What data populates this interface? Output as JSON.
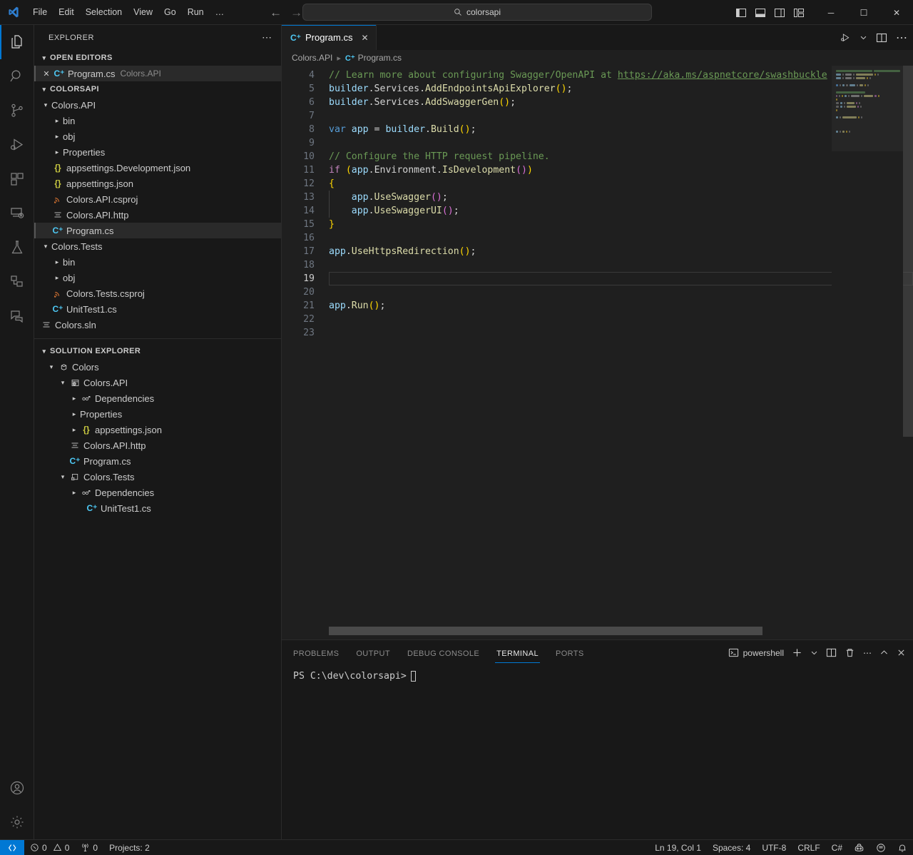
{
  "titlebar": {
    "logo": "vscode-logo-icon",
    "menus": [
      "File",
      "Edit",
      "Selection",
      "View",
      "Go",
      "Run",
      "…"
    ],
    "nav_back": "←",
    "nav_forward": "→",
    "command_center": {
      "text": "colorsapi",
      "icon": "search-icon"
    },
    "layout_icons": [
      "toggle-primary-sidebar-icon",
      "toggle-panel-icon",
      "toggle-secondary-sidebar-icon",
      "customize-layout-icon"
    ],
    "window_controls": {
      "minimize": "─",
      "maximize": "☐",
      "close": "✕"
    }
  },
  "activitybar": {
    "items": [
      {
        "name": "explorer",
        "icon": "files-icon",
        "active": true
      },
      {
        "name": "search",
        "icon": "search-icon",
        "active": false
      },
      {
        "name": "source-control",
        "icon": "source-control-icon",
        "active": false
      },
      {
        "name": "run-and-debug",
        "icon": "run-debug-icon",
        "active": false
      },
      {
        "name": "extensions",
        "icon": "extensions-icon",
        "active": false
      },
      {
        "name": "remote-explorer",
        "icon": "remote-explorer-icon",
        "active": false
      },
      {
        "name": "testing",
        "icon": "beaker-icon",
        "active": false
      },
      {
        "name": "solution-explorer",
        "icon": "solution-icon",
        "active": false
      },
      {
        "name": "chat",
        "icon": "chat-icon",
        "active": false
      }
    ],
    "bottom": [
      {
        "name": "accounts",
        "icon": "account-icon"
      },
      {
        "name": "manage-settings",
        "icon": "gear-icon"
      }
    ]
  },
  "sidebar": {
    "title": "EXPLORER",
    "more_actions": "⋯",
    "open_editors": {
      "label": "OPEN EDITORS",
      "expanded": true,
      "items": [
        {
          "name": "Program.cs",
          "description": "Colors.API",
          "icon": "csharp-icon",
          "selected": true,
          "close": "✕"
        }
      ]
    },
    "folder": {
      "label": "COLORSAPI",
      "expanded": true,
      "items": [
        {
          "label": "Colors.API",
          "depth": 1,
          "type": "folder",
          "expanded": true
        },
        {
          "label": "bin",
          "depth": 2,
          "type": "folder",
          "expanded": false
        },
        {
          "label": "obj",
          "depth": 2,
          "type": "folder",
          "expanded": false
        },
        {
          "label": "Properties",
          "depth": 2,
          "type": "folder",
          "expanded": false
        },
        {
          "label": "appsettings.Development.json",
          "depth": 2,
          "type": "json"
        },
        {
          "label": "appsettings.json",
          "depth": 2,
          "type": "json"
        },
        {
          "label": "Colors.API.csproj",
          "depth": 2,
          "type": "csproj"
        },
        {
          "label": "Colors.API.http",
          "depth": 2,
          "type": "http"
        },
        {
          "label": "Program.cs",
          "depth": 2,
          "type": "cs",
          "selected": true
        },
        {
          "label": "Colors.Tests",
          "depth": 1,
          "type": "folder",
          "expanded": true
        },
        {
          "label": "bin",
          "depth": 2,
          "type": "folder",
          "expanded": false
        },
        {
          "label": "obj",
          "depth": 2,
          "type": "folder",
          "expanded": false
        },
        {
          "label": "Colors.Tests.csproj",
          "depth": 2,
          "type": "csproj"
        },
        {
          "label": "UnitTest1.cs",
          "depth": 2,
          "type": "cs"
        },
        {
          "label": "Colors.sln",
          "depth": 1,
          "type": "sln"
        }
      ]
    },
    "solution_explorer": {
      "label": "SOLUTION EXPLORER",
      "expanded": true,
      "items": [
        {
          "label": "Colors",
          "depth": 1,
          "icon": "solution-icon",
          "twisty": "expanded"
        },
        {
          "label": "Colors.API",
          "depth": 2,
          "icon": "web-project-icon",
          "twisty": "expanded"
        },
        {
          "label": "Dependencies",
          "depth": 3,
          "icon": "dependencies-icon",
          "twisty": "collapsed"
        },
        {
          "label": "Properties",
          "depth": 3,
          "icon": "none",
          "twisty": "collapsed"
        },
        {
          "label": "appsettings.json",
          "depth": 3,
          "icon": "json-icon",
          "twisty": "collapsed"
        },
        {
          "label": "Colors.API.http",
          "depth": 3,
          "icon": "http-icon",
          "twisty": "none"
        },
        {
          "label": "Program.cs",
          "depth": 3,
          "icon": "csharp-icon",
          "twisty": "none"
        },
        {
          "label": "Colors.Tests",
          "depth": 2,
          "icon": "test-project-icon",
          "twisty": "expanded"
        },
        {
          "label": "Dependencies",
          "depth": 3,
          "icon": "dependencies-icon",
          "twisty": "collapsed"
        },
        {
          "label": "UnitTest1.cs",
          "depth": 4,
          "icon": "csharp-icon",
          "twisty": "none"
        }
      ]
    }
  },
  "editor": {
    "tabs": [
      {
        "label": "Program.cs",
        "icon": "csharp-icon",
        "active": true,
        "close": "✕"
      }
    ],
    "actions": [
      "run-or-debug-icon",
      "chevron-down-icon",
      "split-editor-icon",
      "more-actions-icon"
    ],
    "breadcrumbs": [
      {
        "label": "Colors.API",
        "icon": "none"
      },
      {
        "label": "Program.cs",
        "icon": "csharp-icon"
      }
    ],
    "current_line": 19,
    "lines": [
      {
        "n": 4,
        "tokens": [
          {
            "t": "// Learn more about configuring Swagger/OpenAPI at ",
            "c": "com"
          },
          {
            "t": "https://aka.ms/aspnetcore/swashbuckle",
            "c": "lnk"
          }
        ]
      },
      {
        "n": 5,
        "tokens": [
          {
            "t": "builder",
            "c": "id"
          },
          {
            "t": ".",
            "c": "pun"
          },
          {
            "t": "Services",
            "c": "mem"
          },
          {
            "t": ".",
            "c": "pun"
          },
          {
            "t": "AddEndpointsApiExplorer",
            "c": "fn"
          },
          {
            "t": "()",
            "c": "par"
          },
          {
            "t": ";",
            "c": "pun"
          }
        ]
      },
      {
        "n": 6,
        "tokens": [
          {
            "t": "builder",
            "c": "id"
          },
          {
            "t": ".",
            "c": "pun"
          },
          {
            "t": "Services",
            "c": "mem"
          },
          {
            "t": ".",
            "c": "pun"
          },
          {
            "t": "AddSwaggerGen",
            "c": "fn"
          },
          {
            "t": "()",
            "c": "par"
          },
          {
            "t": ";",
            "c": "pun"
          }
        ]
      },
      {
        "n": 7,
        "tokens": []
      },
      {
        "n": 8,
        "tokens": [
          {
            "t": "var",
            "c": "kw"
          },
          {
            "t": " ",
            "c": "pun"
          },
          {
            "t": "app",
            "c": "id"
          },
          {
            "t": " = ",
            "c": "pun"
          },
          {
            "t": "builder",
            "c": "id"
          },
          {
            "t": ".",
            "c": "pun"
          },
          {
            "t": "Build",
            "c": "fn"
          },
          {
            "t": "()",
            "c": "par"
          },
          {
            "t": ";",
            "c": "pun"
          }
        ]
      },
      {
        "n": 9,
        "tokens": []
      },
      {
        "n": 10,
        "tokens": [
          {
            "t": "// Configure the HTTP request pipeline.",
            "c": "com"
          }
        ]
      },
      {
        "n": 11,
        "tokens": [
          {
            "t": "if",
            "c": "kw2"
          },
          {
            "t": " ",
            "c": "pun"
          },
          {
            "t": "(",
            "c": "par"
          },
          {
            "t": "app",
            "c": "id"
          },
          {
            "t": ".",
            "c": "pun"
          },
          {
            "t": "Environment",
            "c": "mem"
          },
          {
            "t": ".",
            "c": "pun"
          },
          {
            "t": "IsDevelopment",
            "c": "fn"
          },
          {
            "t": "()",
            "c": "par2"
          },
          {
            "t": ")",
            "c": "par"
          }
        ]
      },
      {
        "n": 12,
        "tokens": [
          {
            "t": "{",
            "c": "br"
          }
        ]
      },
      {
        "n": 13,
        "tokens": [
          {
            "t": "    ",
            "c": "pun"
          },
          {
            "t": "app",
            "c": "id"
          },
          {
            "t": ".",
            "c": "pun"
          },
          {
            "t": "UseSwagger",
            "c": "fn"
          },
          {
            "t": "()",
            "c": "par2"
          },
          {
            "t": ";",
            "c": "pun"
          }
        ]
      },
      {
        "n": 14,
        "tokens": [
          {
            "t": "    ",
            "c": "pun"
          },
          {
            "t": "app",
            "c": "id"
          },
          {
            "t": ".",
            "c": "pun"
          },
          {
            "t": "UseSwaggerUI",
            "c": "fn"
          },
          {
            "t": "()",
            "c": "par2"
          },
          {
            "t": ";",
            "c": "pun"
          }
        ]
      },
      {
        "n": 15,
        "tokens": [
          {
            "t": "}",
            "c": "br"
          }
        ]
      },
      {
        "n": 16,
        "tokens": []
      },
      {
        "n": 17,
        "tokens": [
          {
            "t": "app",
            "c": "id"
          },
          {
            "t": ".",
            "c": "pun"
          },
          {
            "t": "UseHttpsRedirection",
            "c": "fn"
          },
          {
            "t": "()",
            "c": "par"
          },
          {
            "t": ";",
            "c": "pun"
          }
        ]
      },
      {
        "n": 18,
        "tokens": []
      },
      {
        "n": 19,
        "tokens": []
      },
      {
        "n": 20,
        "tokens": []
      },
      {
        "n": 21,
        "tokens": [
          {
            "t": "app",
            "c": "id"
          },
          {
            "t": ".",
            "c": "pun"
          },
          {
            "t": "Run",
            "c": "fn"
          },
          {
            "t": "()",
            "c": "par"
          },
          {
            "t": ";",
            "c": "pun"
          }
        ]
      },
      {
        "n": 22,
        "tokens": []
      },
      {
        "n": 23,
        "tokens": []
      }
    ]
  },
  "panel": {
    "tabs": [
      {
        "label": "PROBLEMS",
        "active": false
      },
      {
        "label": "OUTPUT",
        "active": false
      },
      {
        "label": "DEBUG CONSOLE",
        "active": false
      },
      {
        "label": "TERMINAL",
        "active": true
      },
      {
        "label": "PORTS",
        "active": false
      }
    ],
    "shell_label": "powershell",
    "shell_icon": "terminal-icon",
    "actions": [
      "new-terminal-icon",
      "chevron-down-icon",
      "split-terminal-icon",
      "kill-terminal-icon",
      "more-actions-icon",
      "maximize-panel-icon",
      "close-panel-icon"
    ],
    "terminal_prompt": "PS C:\\dev\\colorsapi>"
  },
  "statusbar": {
    "remote_icon": "remote-indicator-icon",
    "left": [
      {
        "name": "problems",
        "icon": "error-icon",
        "text": "0",
        "icon2": "warning-icon",
        "text2": "0"
      },
      {
        "name": "ports-forwarded",
        "icon": "radio-tower-icon",
        "text": "0"
      },
      {
        "name": "projects",
        "text": "Projects: 2"
      }
    ],
    "right": [
      {
        "name": "editor-position",
        "text": "Ln 19, Col 1"
      },
      {
        "name": "indentation",
        "text": "Spaces: 4"
      },
      {
        "name": "encoding",
        "text": "UTF-8"
      },
      {
        "name": "eol",
        "text": "CRLF"
      },
      {
        "name": "language-mode",
        "text": "C#"
      },
      {
        "name": "copilot",
        "icon": "copilot-icon"
      },
      {
        "name": "feedback",
        "icon": "feedback-icon"
      },
      {
        "name": "notifications",
        "icon": "bell-icon"
      }
    ]
  },
  "colors": {
    "accent": "#0078d4",
    "titlebar_bg": "#181818",
    "editor_bg": "#1f1f1f",
    "sidebar_bg": "#181818",
    "comment": "#6a9955",
    "identifier": "#9cdcfe",
    "function": "#dcdcaa",
    "keyword": "#569cd6",
    "control_keyword": "#c586c0",
    "bracket1": "#ffd700",
    "bracket2": "#da70d6",
    "csharp_icon": "#4ec9f5",
    "json_icon": "#cbcb41",
    "csproj_icon": "#e37933"
  }
}
